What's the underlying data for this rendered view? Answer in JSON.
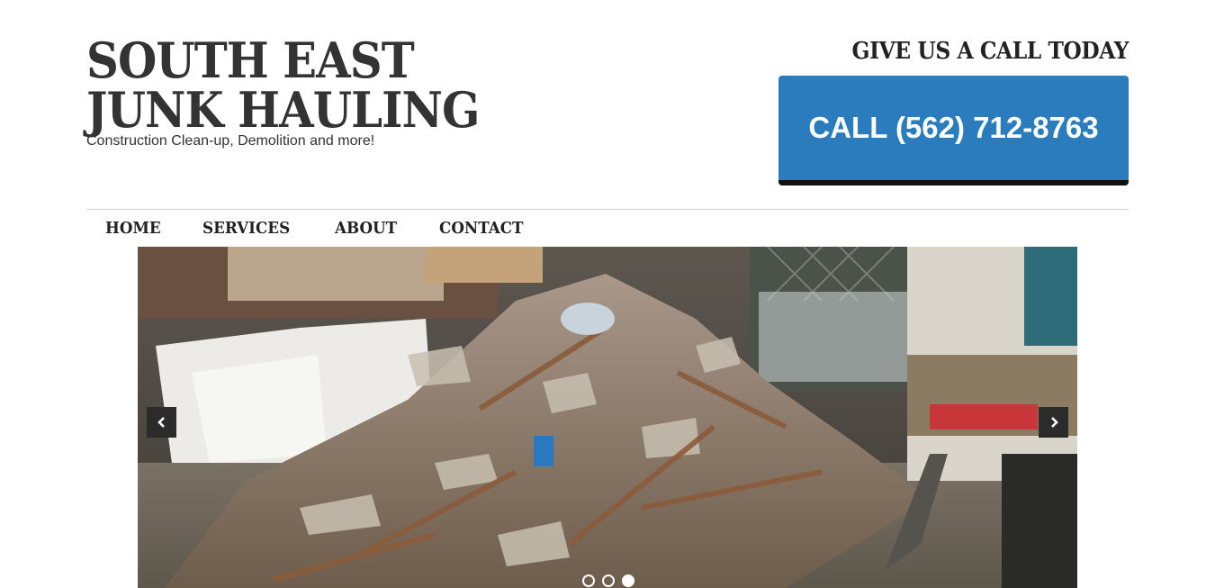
{
  "header": {
    "title_line1": "SOUTH EAST",
    "title_line2": "JUNK HAULING",
    "tagline": "Construction Clean-up, Demolition and more!"
  },
  "call": {
    "heading": "GIVE US A CALL TODAY",
    "button_label": "CALL (562) 712-8763",
    "button_color": "#2a7cbd"
  },
  "nav": {
    "items": [
      {
        "label": "HOME"
      },
      {
        "label": "SERVICES"
      },
      {
        "label": "ABOUT"
      },
      {
        "label": "CONTACT"
      }
    ]
  },
  "slider": {
    "image": "pile of construction debris next to a truck",
    "prev_icon": "chevron-left-icon",
    "next_icon": "chevron-right-icon",
    "slide_count": 3,
    "active_slide": 3
  }
}
